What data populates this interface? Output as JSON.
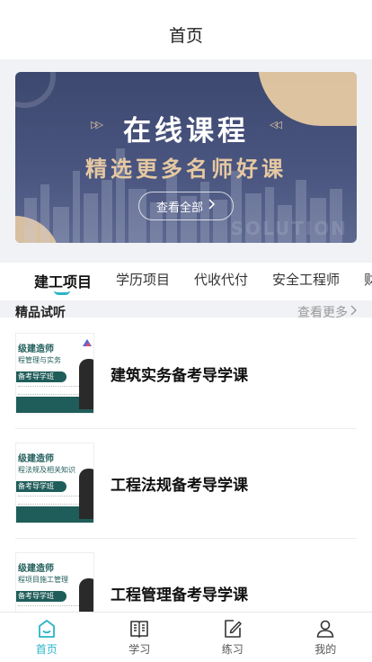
{
  "header": {
    "title": "首页"
  },
  "banner": {
    "title": "在线课程",
    "subtitle": "精选更多名师好课",
    "button_label": "查看全部",
    "watermark": "SOLUTION",
    "accent_color": "#e6c9a2",
    "bg_color": "#44507a"
  },
  "tabs": [
    {
      "label": "建工项目",
      "active": true
    },
    {
      "label": "学历项目",
      "active": false
    },
    {
      "label": "代收代付",
      "active": false
    },
    {
      "label": "安全工程师",
      "active": false
    },
    {
      "label": "财",
      "active": false
    }
  ],
  "section": {
    "title": "精品试听",
    "more_label": "查看更多"
  },
  "courses": [
    {
      "name": "建筑实务备考导学课",
      "thumb_line1": "级建造师",
      "thumb_line2": "程管理与实务",
      "thumb_pill": "备考导学班"
    },
    {
      "name": "工程法规备考导学课",
      "thumb_line1": "级建造师",
      "thumb_line2": "程法规及相关知识",
      "thumb_pill": "备考导学班"
    },
    {
      "name": "工程管理备考导学课",
      "thumb_line1": "级建造师",
      "thumb_line2": "程项目施工管理",
      "thumb_pill": "备考导学班"
    }
  ],
  "tabbar": {
    "accent_color": "#2ab4c9",
    "items": [
      {
        "label": "首页",
        "icon": "home-icon",
        "active": true
      },
      {
        "label": "学习",
        "icon": "book-icon",
        "active": false
      },
      {
        "label": "练习",
        "icon": "edit-icon",
        "active": false
      },
      {
        "label": "我的",
        "icon": "user-icon",
        "active": false
      }
    ]
  }
}
